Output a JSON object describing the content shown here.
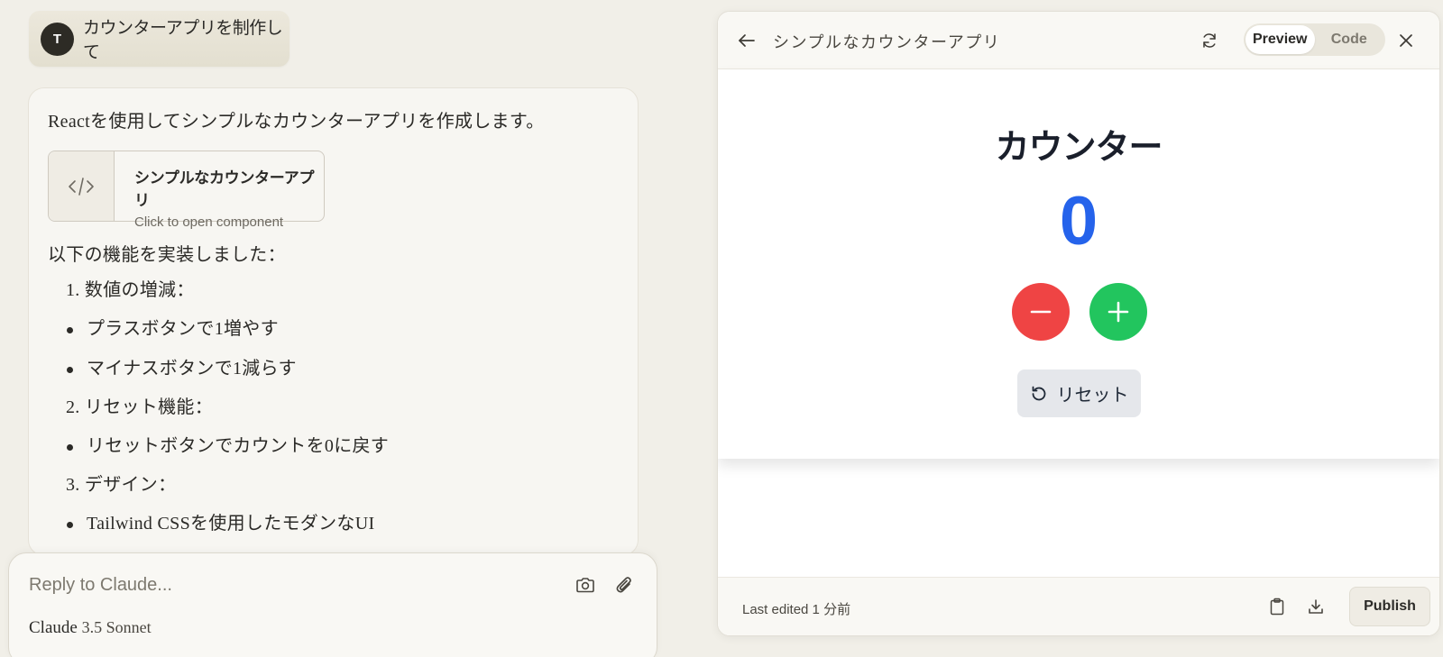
{
  "user_message": {
    "avatar_initial": "T",
    "text": "カウンターアプリを制作して"
  },
  "assistant_message": {
    "intro": "Reactを使用してシンプルなカウンターアプリを作成します。",
    "artifact_card": {
      "icon": "code-icon",
      "title": "シンプルなカウンターアプリ",
      "subtitle": "Click to open component"
    },
    "features_heading": "以下の機能を実装しました：",
    "items": [
      {
        "type": "num",
        "text": "1. 数値の増減："
      },
      {
        "type": "bullet",
        "text": "プラスボタンで1増やす"
      },
      {
        "type": "bullet",
        "text": "マイナスボタンで1減らす"
      },
      {
        "type": "num",
        "text": "2. リセット機能："
      },
      {
        "type": "bullet",
        "text": "リセットボタンでカウントを0に戻す"
      },
      {
        "type": "num",
        "text": "3. デザイン："
      },
      {
        "type": "bullet",
        "text": "Tailwind CSSを使用したモダンなUI"
      }
    ]
  },
  "reply": {
    "placeholder": "Reply to Claude...",
    "model_name": "Claude",
    "model_version": "3.5 Sonnet"
  },
  "panel": {
    "title": "シンプルなカウンターアプリ",
    "tabs": {
      "preview": "Preview",
      "code": "Code"
    },
    "active_tab": "Preview",
    "app": {
      "heading": "カウンター",
      "value": "0",
      "reset_label": "リセット",
      "colors": {
        "value": "#2563eb",
        "minus": "#ef4444",
        "plus": "#22c55e",
        "reset_bg": "#e5e7eb"
      }
    },
    "footer": {
      "last_edited": "Last edited 1 分前",
      "publish_label": "Publish"
    }
  }
}
